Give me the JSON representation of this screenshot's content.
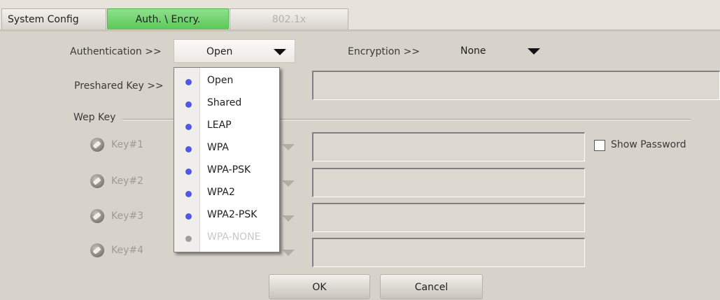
{
  "tabs": [
    {
      "label": "System Config"
    },
    {
      "label": "Auth. \\ Encry."
    },
    {
      "label": "802.1x"
    }
  ],
  "authentication": {
    "label": "Authentication >>",
    "value": "Open"
  },
  "encryption": {
    "label": "Encryption >>",
    "value": "None"
  },
  "preshared_key": {
    "label": "Preshared Key >>",
    "value": ""
  },
  "wep_key": {
    "group_label": "Wep Key",
    "keys": [
      {
        "label": "Key#1",
        "value": ""
      },
      {
        "label": "Key#2",
        "value": ""
      },
      {
        "label": "Key#3",
        "value": ""
      },
      {
        "label": "Key#4",
        "value": ""
      }
    ]
  },
  "show_password": {
    "label": "Show Password",
    "checked": false
  },
  "buttons": {
    "ok": "OK",
    "cancel": "Cancel"
  },
  "auth_dropdown": {
    "items": [
      {
        "label": "Open",
        "enabled": true
      },
      {
        "label": "Shared",
        "enabled": true
      },
      {
        "label": "LEAP",
        "enabled": true
      },
      {
        "label": "WPA",
        "enabled": true
      },
      {
        "label": "WPA-PSK",
        "enabled": true
      },
      {
        "label": "WPA2",
        "enabled": true
      },
      {
        "label": "WPA2-PSK",
        "enabled": true
      },
      {
        "label": "WPA-NONE",
        "enabled": false
      }
    ]
  },
  "colors": {
    "background": "#d8d3ca",
    "active_tab": "#6fd46d",
    "dropdown_bullet": "#5457e6"
  }
}
